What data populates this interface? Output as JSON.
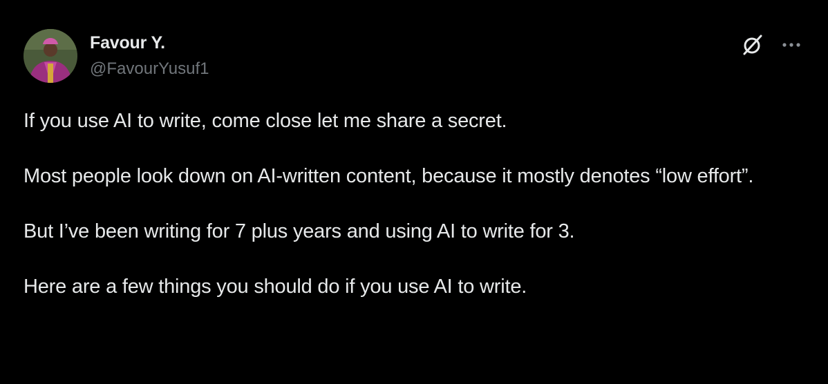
{
  "author": {
    "display_name": "Favour Y.",
    "handle": "@FavourYusuf1",
    "avatar": "profile-photo-icon"
  },
  "actions": {
    "grok": "grok-icon",
    "more": "more-options-icon"
  },
  "tweet": {
    "paragraphs": [
      "If you use AI to write, come close let me share a secret.",
      "Most people look down on AI-written content, because it mostly denotes “low effort”.",
      "But I’ve been writing for 7 plus years and using AI to write for 3.",
      "Here are a few things you should do if you use AI to write."
    ]
  },
  "colors": {
    "background": "#000000",
    "text": "#e7e9ea",
    "secondary_text": "#71767b"
  }
}
